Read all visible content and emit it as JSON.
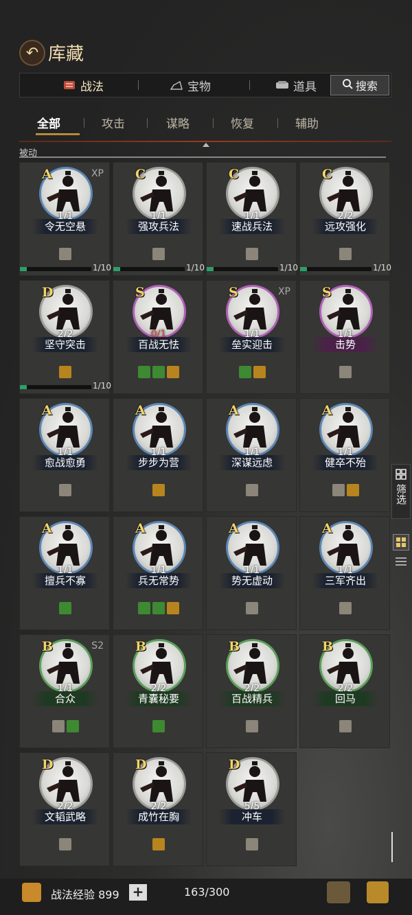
{
  "header": {
    "title": "库藏"
  },
  "tabs": [
    {
      "label": "战法",
      "icon": "scroll-icon"
    },
    {
      "label": "宝物",
      "icon": "treasure-icon"
    },
    {
      "label": "道具",
      "icon": "item-icon"
    }
  ],
  "search": {
    "label": "搜索"
  },
  "subtabs": [
    "全部",
    "攻击",
    "谋略",
    "恢复",
    "辅助"
  ],
  "sort_label": "被动",
  "cards": [
    {
      "rank": "A",
      "name": "令无空悬",
      "level": "1/1",
      "tag": "XP",
      "border": "blue",
      "badges": [
        "gray"
      ],
      "progress": "1/10",
      "fill": 0.1
    },
    {
      "rank": "C",
      "name": "强攻兵法",
      "level": "1/1",
      "tag": "",
      "border": "gray",
      "badges": [
        "gray"
      ],
      "progress": "1/10",
      "fill": 0.1
    },
    {
      "rank": "C",
      "name": "速战兵法",
      "level": "1/1",
      "tag": "",
      "border": "gray",
      "badges": [
        "gray"
      ],
      "progress": "1/10",
      "fill": 0.1
    },
    {
      "rank": "C",
      "name": "远攻强化",
      "level": "2/2",
      "tag": "",
      "border": "gray",
      "badges": [
        "gray"
      ],
      "progress": "1/10",
      "fill": 0.1
    },
    {
      "rank": "D",
      "name": "坚守突击",
      "level": "2/2",
      "tag": "",
      "border": "gray",
      "badges": [
        "gold"
      ],
      "progress": "1/10",
      "fill": 0.1
    },
    {
      "rank": "S",
      "name": "百战无怯",
      "level": "0/1",
      "tag": "",
      "border": "purple",
      "badges": [
        "green",
        "green",
        "gold"
      ],
      "levelRed": true
    },
    {
      "rank": "S",
      "name": "垒实迎击",
      "level": "1/1",
      "tag": "XP",
      "border": "purple",
      "badges": [
        "green",
        "gold"
      ]
    },
    {
      "rank": "S",
      "name": "击势",
      "level": "1/1",
      "tag": "",
      "border": "purple",
      "badges": [
        "gray"
      ],
      "namePurple": true
    },
    {
      "rank": "A",
      "name": "愈战愈勇",
      "level": "1/1",
      "tag": "",
      "border": "blue",
      "badges": [
        "gray"
      ]
    },
    {
      "rank": "A",
      "name": "步步为营",
      "level": "1/1",
      "tag": "",
      "border": "blue",
      "badges": [
        "gold"
      ]
    },
    {
      "rank": "A",
      "name": "深谋远虑",
      "level": "1/1",
      "tag": "",
      "border": "blue",
      "badges": [
        "gray"
      ]
    },
    {
      "rank": "A",
      "name": "健卒不殆",
      "level": "1/1",
      "tag": "",
      "border": "blue",
      "badges": [
        "gray",
        "gold"
      ]
    },
    {
      "rank": "A",
      "name": "擅兵不寡",
      "level": "1/1",
      "tag": "",
      "border": "blue",
      "badges": [
        "green"
      ]
    },
    {
      "rank": "A",
      "name": "兵无常势",
      "level": "1/1",
      "tag": "",
      "border": "blue",
      "badges": [
        "green",
        "green",
        "gold"
      ]
    },
    {
      "rank": "A",
      "name": "势无虚动",
      "level": "1/1",
      "tag": "",
      "border": "blue",
      "badges": [
        "gray"
      ]
    },
    {
      "rank": "A",
      "name": "三军齐出",
      "level": "1/1",
      "tag": "",
      "border": "blue",
      "badges": [
        "gray"
      ]
    },
    {
      "rank": "B",
      "name": "合众",
      "level": "1/1",
      "tag": "S2",
      "border": "green",
      "badges": [
        "gray",
        "green"
      ],
      "nameGreen": true
    },
    {
      "rank": "B",
      "name": "青囊秘要",
      "level": "2/2",
      "tag": "",
      "border": "green",
      "badges": [
        "green"
      ],
      "nameGreen": true
    },
    {
      "rank": "B",
      "name": "百战精兵",
      "level": "2/2",
      "tag": "",
      "border": "green",
      "badges": [
        "gray"
      ],
      "nameGreen": true
    },
    {
      "rank": "B",
      "name": "回马",
      "level": "2/2",
      "tag": "",
      "border": "green",
      "badges": [
        "gray"
      ],
      "nameGreen": true
    },
    {
      "rank": "D",
      "name": "文韬武略",
      "level": "2/2",
      "tag": "",
      "border": "gray",
      "badges": [
        "gray"
      ]
    },
    {
      "rank": "D",
      "name": "成竹在胸",
      "level": "2/2",
      "tag": "",
      "border": "gray",
      "badges": [
        "gold"
      ]
    },
    {
      "rank": "D",
      "name": "冲车",
      "level": "5/5",
      "tag": "",
      "border": "gray",
      "badges": [
        "gray"
      ]
    }
  ],
  "side": {
    "filter_label": "筛选"
  },
  "footer": {
    "exp_label": "战法经验 899",
    "count": "163/300"
  }
}
